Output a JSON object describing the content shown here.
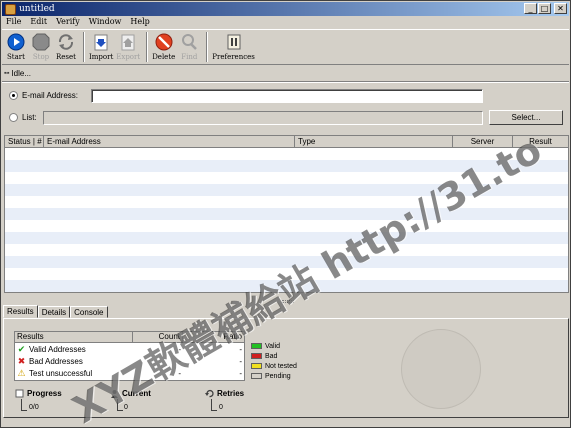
{
  "window": {
    "title": "untitled",
    "buttons": {
      "minimize": "_",
      "maximize": "□",
      "close": "✕"
    }
  },
  "menu": [
    "File",
    "Edit",
    "Verify",
    "Window",
    "Help"
  ],
  "toolbar": {
    "start": "Start",
    "stop": "Stop",
    "reset": "Reset",
    "import": "Import",
    "export": "Export",
    "delete": "Delete",
    "find": "Find",
    "preferences": "Preferences"
  },
  "status": {
    "text": "Idle..."
  },
  "inputs": {
    "email_label": "E-mail Address:",
    "email_value": "",
    "list_label": "List:",
    "list_value": "",
    "select_button": "Select..."
  },
  "table": {
    "columns": [
      "Status",
      "#",
      "E-mail Address",
      "Type",
      "Server",
      "Result"
    ]
  },
  "tabs": [
    "Results",
    "Details",
    "Console"
  ],
  "results": {
    "headers": [
      "Results",
      "Count",
      "Ratio"
    ],
    "rows": [
      {
        "label": "Valid Addresses",
        "count": "-",
        "ratio": "-",
        "icon": "check-icon"
      },
      {
        "label": "Bad Addresses",
        "count": "-",
        "ratio": "-",
        "icon": "x-icon"
      },
      {
        "label": "Test unsuccessful",
        "count": "-",
        "ratio": "-",
        "icon": "warning-icon"
      }
    ]
  },
  "legend": [
    {
      "label": "Valid",
      "color": "#22c022"
    },
    {
      "label": "Bad",
      "color": "#d02020"
    },
    {
      "label": "Not tested",
      "color": "#f0e020"
    },
    {
      "label": "Pending",
      "color": "#d4d0c8"
    }
  ],
  "stats": {
    "progress_label": "Progress",
    "progress_value": "0/0",
    "current_label": "Current",
    "current_value": "0",
    "retries_label": "Retries",
    "retries_value": "0"
  },
  "watermark": {
    "text1": "XYZ軟體補給站",
    "text2": "http://31.to"
  }
}
